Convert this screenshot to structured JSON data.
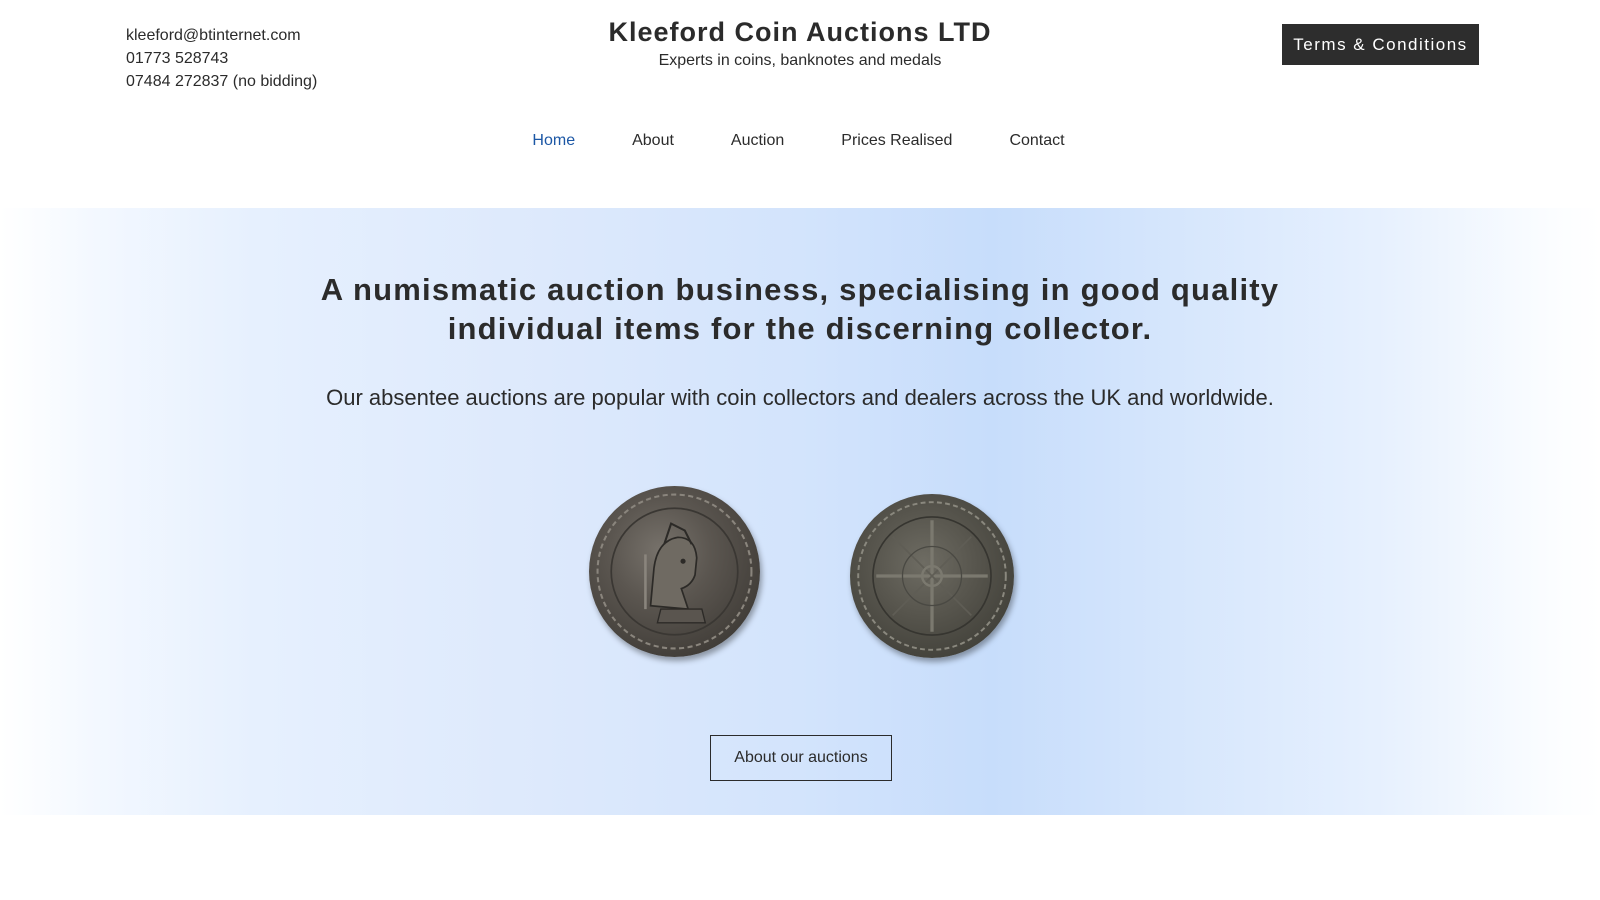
{
  "contact": {
    "email": "kleeford@btinternet.com",
    "phone": "01773 528743",
    "mobile": "07484 272837 (no bidding)"
  },
  "brand": {
    "title": "Kleeford Coin Auctions LTD",
    "tagline": "Experts in coins, banknotes and medals"
  },
  "terms_button": "Terms & Conditions",
  "nav": [
    {
      "label": "Home",
      "active": true
    },
    {
      "label": "About",
      "active": false
    },
    {
      "label": "Auction",
      "active": false
    },
    {
      "label": "Prices Realised",
      "active": false
    },
    {
      "label": "Contact",
      "active": false
    }
  ],
  "hero": {
    "headline_line1": "A numismatic auction business, specialising in good quality",
    "headline_line2": "individual items for the discerning collector.",
    "subline": "Our absentee auctions are popular with coin collectors and dealers across the UK and worldwide.",
    "cta": "About our auctions"
  },
  "colors": {
    "accent": "#1c57a5",
    "dark": "#2d2d2d",
    "hero_blue": "#c7ddfb"
  }
}
